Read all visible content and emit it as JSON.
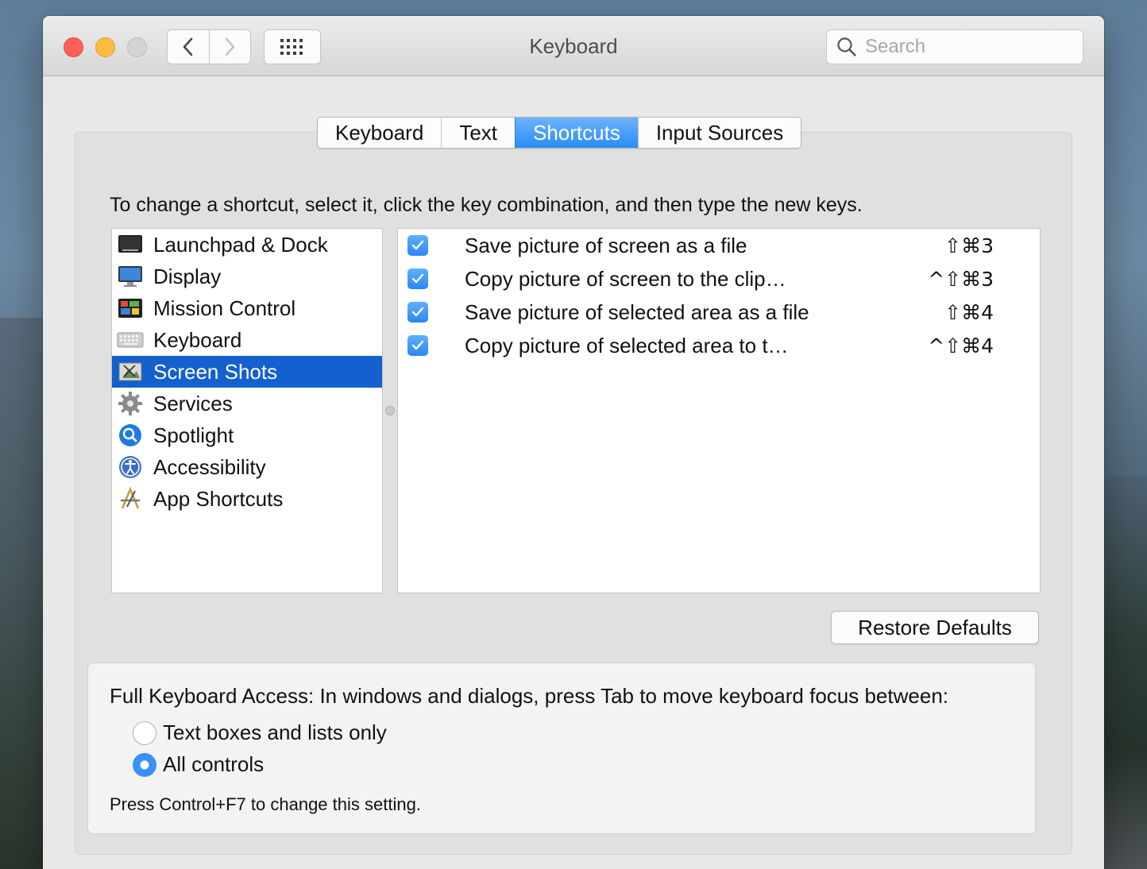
{
  "window": {
    "title": "Keyboard",
    "search_placeholder": "Search"
  },
  "toolbar": {
    "back_icon": "chevron-left-icon",
    "forward_icon": "chevron-right-icon",
    "grid_icon": "show-all-grid-icon"
  },
  "tabs": [
    {
      "label": "Keyboard",
      "active": false
    },
    {
      "label": "Text",
      "active": false
    },
    {
      "label": "Shortcuts",
      "active": true
    },
    {
      "label": "Input Sources",
      "active": false
    }
  ],
  "instructions": "To change a shortcut, select it, click the key combination, and then type the new keys.",
  "categories": [
    {
      "label": "Launchpad & Dock",
      "icon": "launchpad-dock-icon",
      "selected": false
    },
    {
      "label": "Display",
      "icon": "display-icon",
      "selected": false
    },
    {
      "label": "Mission Control",
      "icon": "mission-control-icon",
      "selected": false
    },
    {
      "label": "Keyboard",
      "icon": "keyboard-icon",
      "selected": false
    },
    {
      "label": "Screen Shots",
      "icon": "screenshot-icon",
      "selected": true
    },
    {
      "label": "Services",
      "icon": "gear-icon",
      "selected": false
    },
    {
      "label": "Spotlight",
      "icon": "spotlight-icon",
      "selected": false
    },
    {
      "label": "Accessibility",
      "icon": "accessibility-icon",
      "selected": false
    },
    {
      "label": "App Shortcuts",
      "icon": "app-shortcuts-icon",
      "selected": false
    }
  ],
  "shortcuts": [
    {
      "checked": true,
      "label": "Save picture of screen as a file",
      "keys": "⇧⌘3"
    },
    {
      "checked": true,
      "label": "Copy picture of screen to the clip…",
      "keys": "^⇧⌘3"
    },
    {
      "checked": true,
      "label": "Save picture of selected area as a file",
      "keys": "⇧⌘4"
    },
    {
      "checked": true,
      "label": "Copy picture of selected area to t…",
      "keys": "^⇧⌘4"
    }
  ],
  "restore_defaults_label": "Restore Defaults",
  "full_keyboard_access": {
    "title": "Full Keyboard Access: In windows and dialogs, press Tab to move keyboard focus between:",
    "options": [
      {
        "label": "Text boxes and lists only",
        "selected": false
      },
      {
        "label": "All controls",
        "selected": true
      }
    ],
    "note": "Press Control+F7 to change this setting."
  },
  "colors": {
    "accent": "#2a8cf7",
    "selection": "#1560cf",
    "close": "#fc605b",
    "minimize": "#fdbc40"
  }
}
